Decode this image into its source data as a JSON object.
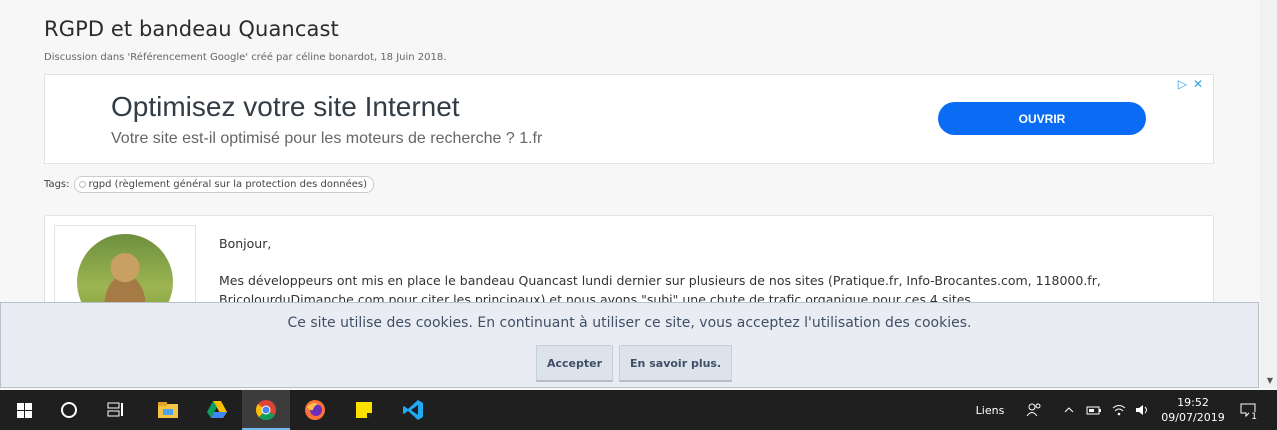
{
  "thread": {
    "title": "RGPD et bandeau Quancast",
    "meta": "Discussion dans 'Référencement Google' créé par céline bonardot, 18 Juin 2018."
  },
  "ad": {
    "headline": "Optimisez votre site Internet",
    "subline": "Votre site est-il optimisé pour les moteurs de recherche ? 1.fr",
    "button_label": "OUVRIR",
    "icons": [
      "adchoices-icon",
      "close-icon"
    ]
  },
  "tags": {
    "label": "Tags:",
    "items": [
      "rgpd (règlement général sur la protection des données)"
    ]
  },
  "post": {
    "greeting": "Bonjour,",
    "line1": "Mes développeurs ont mis en place le bandeau Quancast lundi dernier sur plusieurs de nos sites (Pratique.fr, Info-Brocantes.com, 118000.fr,",
    "line2": "BricolourduDimanche.com pour citer les principaux) et nous avons \"subi\" une chute de trafic organique pour ces 4 sites."
  },
  "cookie_notice": {
    "message": "Ce site utilise des cookies. En continuant à utiliser ce site, vous acceptez l'utilisation des cookies.",
    "accept_label": "Accepter",
    "learn_more_label": "En savoir plus."
  },
  "taskbar": {
    "apps": [
      "start-icon",
      "search-icon",
      "task-view-icon",
      "file-explorer-icon",
      "google-drive-icon",
      "chrome-icon",
      "firefox-icon",
      "sticky-notes-icon",
      "vscode-icon"
    ],
    "links_label": "Liens",
    "time": "19:52",
    "date": "09/07/2019",
    "notification_count": "1"
  },
  "colors": {
    "ad_button": "#0a6cf5",
    "cookie_bar_bg": "#e9edf3",
    "taskbar_bg": "#1f1f1f",
    "active_indicator": "#76b9ed"
  }
}
